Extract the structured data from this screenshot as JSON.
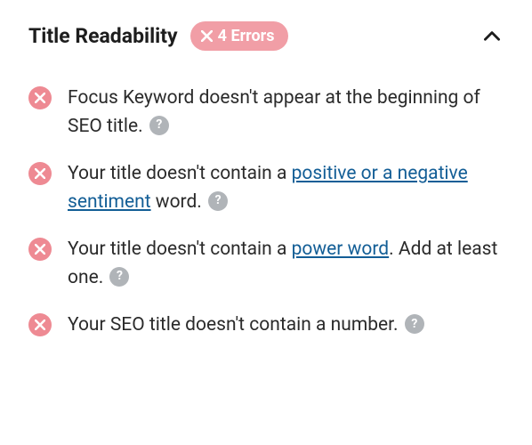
{
  "section": {
    "title": "Title Readability",
    "badge_text": "4 Errors"
  },
  "items": [
    {
      "pre": "Focus Keyword doesn't appear at the beginning of SEO title.",
      "link": "",
      "post": ""
    },
    {
      "pre": "Your title doesn't contain a ",
      "link": "positive or a negative sentiment",
      "post": " word."
    },
    {
      "pre": "Your title doesn't contain a ",
      "link": "power word",
      "post": ". Add at least one."
    },
    {
      "pre": "Your SEO title doesn't contain a number.",
      "link": "",
      "post": ""
    }
  ]
}
